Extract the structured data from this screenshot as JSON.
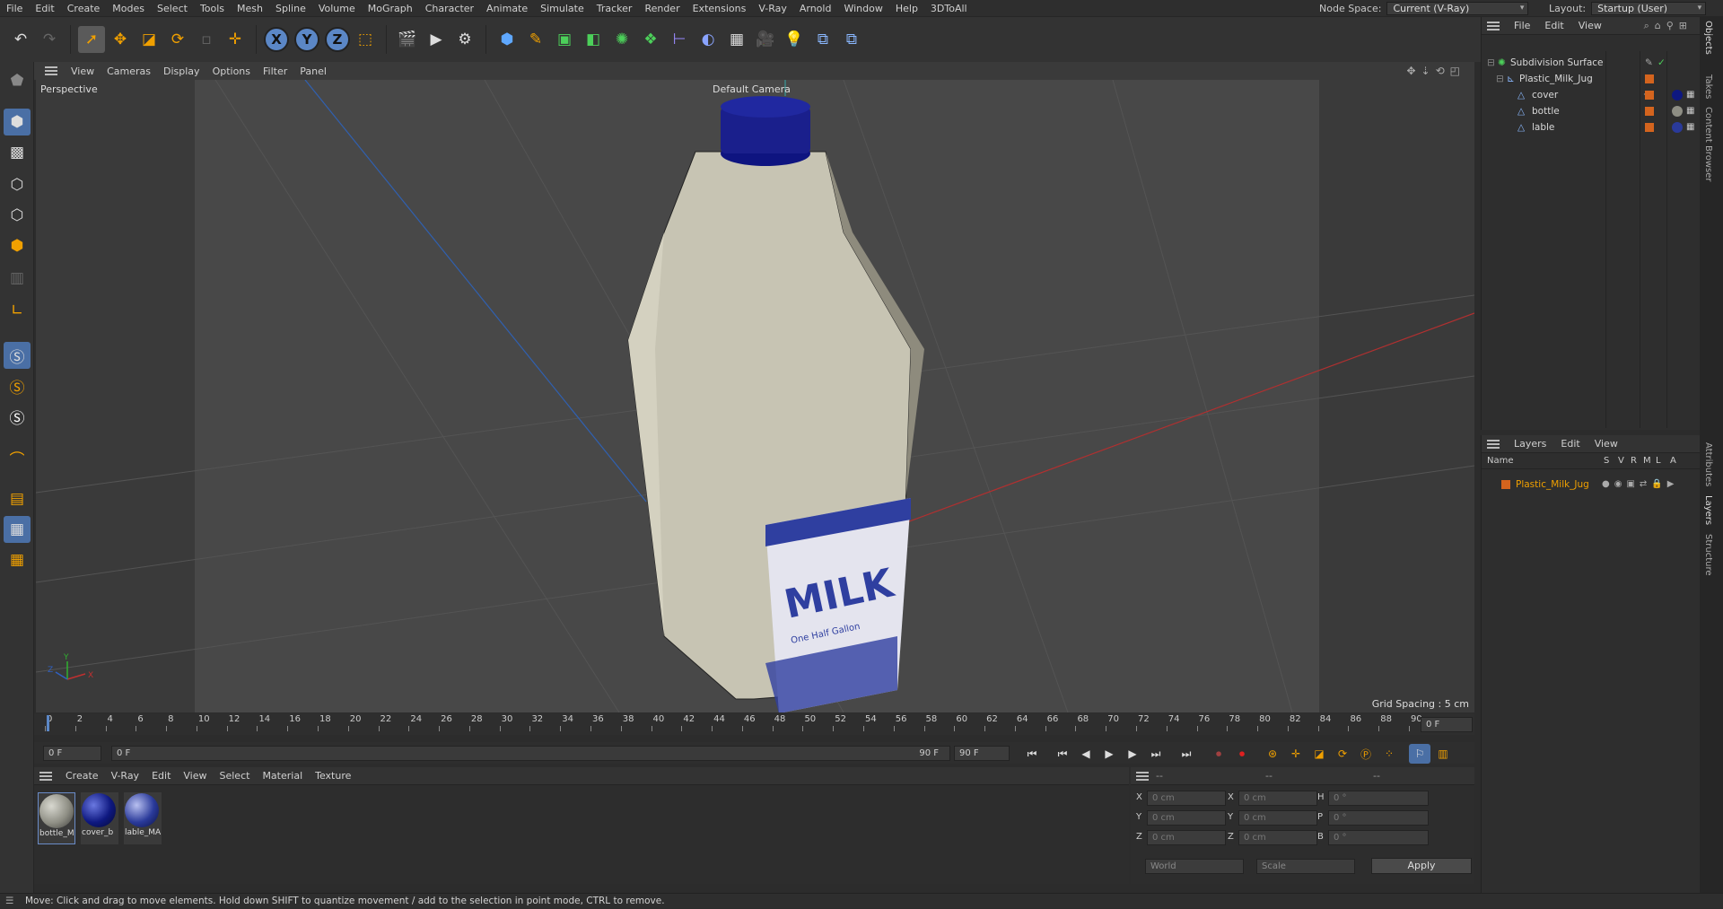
{
  "menubar": {
    "items": [
      "File",
      "Edit",
      "Create",
      "Modes",
      "Select",
      "Tools",
      "Mesh",
      "Spline",
      "Volume",
      "MoGraph",
      "Character",
      "Animate",
      "Simulate",
      "Tracker",
      "Render",
      "Extensions",
      "V-Ray",
      "Arnold",
      "Window",
      "Help",
      "3DToAll"
    ],
    "node_space_label": "Node Space:",
    "node_space_value": "Current (V-Ray)",
    "layout_label": "Layout:",
    "layout_value": "Startup (User)"
  },
  "toolbar": {
    "x_label": "X",
    "y_label": "Y",
    "z_label": "Z"
  },
  "viewport": {
    "menu": [
      "View",
      "Cameras",
      "Display",
      "Options",
      "Filter",
      "Panel"
    ],
    "view_name": "Perspective",
    "camera_label": "Default Camera",
    "grid_spacing": "Grid Spacing : 5 cm",
    "axis_x": "X",
    "axis_y": "Y",
    "axis_z": "Z",
    "label_title": "MILK",
    "label_sub": "One Half Gallon",
    "colors": {
      "bottle": "#c7c4b3",
      "cap": "#1a1f8c",
      "label_blue": "#2f3fa0"
    }
  },
  "timeline": {
    "ticks": [
      "0",
      "2",
      "4",
      "6",
      "8",
      "10",
      "12",
      "14",
      "16",
      "18",
      "20",
      "22",
      "24",
      "26",
      "28",
      "30",
      "32",
      "34",
      "36",
      "38",
      "40",
      "42",
      "44",
      "46",
      "48",
      "50",
      "52",
      "54",
      "56",
      "58",
      "60",
      "62",
      "64",
      "66",
      "68",
      "70",
      "72",
      "74",
      "76",
      "78",
      "80",
      "82",
      "84",
      "86",
      "88",
      "90"
    ],
    "current_frame": "0 F",
    "start_field": "0 F",
    "range_start": "0 F",
    "range_end": "90 F",
    "end_field": "90 F"
  },
  "materials": {
    "menu": [
      "Create",
      "V-Ray",
      "Edit",
      "View",
      "Select",
      "Material",
      "Texture"
    ],
    "items": [
      {
        "label": "bottle_M",
        "color": "#8e8e84"
      },
      {
        "label": "cover_b",
        "color": "#0e1880"
      },
      {
        "label": "lable_MA",
        "color": "#2a3a9a"
      }
    ]
  },
  "attributes": {
    "head": [
      "--",
      "--",
      "--"
    ],
    "rows": [
      {
        "axis1": "X",
        "val1": "0 cm",
        "axis2": "X",
        "val2": "0 cm",
        "axis3": "H",
        "val3": "0 °"
      },
      {
        "axis1": "Y",
        "val1": "0 cm",
        "axis2": "Y",
        "val2": "0 cm",
        "axis3": "P",
        "val3": "0 °"
      },
      {
        "axis1": "Z",
        "val1": "0 cm",
        "axis2": "Z",
        "val2": "0 cm",
        "axis3": "B",
        "val3": "0 °"
      }
    ],
    "coord_system": "World",
    "mode": "Scale",
    "apply_label": "Apply"
  },
  "objects": {
    "menu": [
      "File",
      "Edit",
      "View"
    ],
    "items": [
      {
        "name": "Subdivision Surface"
      },
      {
        "name": "Plastic_Milk_Jug"
      },
      {
        "name": "cover"
      },
      {
        "name": "bottle"
      },
      {
        "name": "lable"
      }
    ]
  },
  "layers": {
    "menu": [
      "Layers",
      "Edit",
      "View"
    ],
    "columns": [
      "Name",
      "S",
      "V",
      "R",
      "M",
      "L",
      "A"
    ],
    "items": [
      {
        "name": "Plastic_Milk_Jug",
        "color": "#d4641e"
      }
    ]
  },
  "side_tabs": [
    "Objects",
    "Takes",
    "Content Browser",
    "Attributes",
    "Layers",
    "Structure"
  ],
  "status": {
    "text": "Move: Click and drag to move elements. Hold down SHIFT to quantize movement / add to the selection in point mode, CTRL to remove."
  }
}
